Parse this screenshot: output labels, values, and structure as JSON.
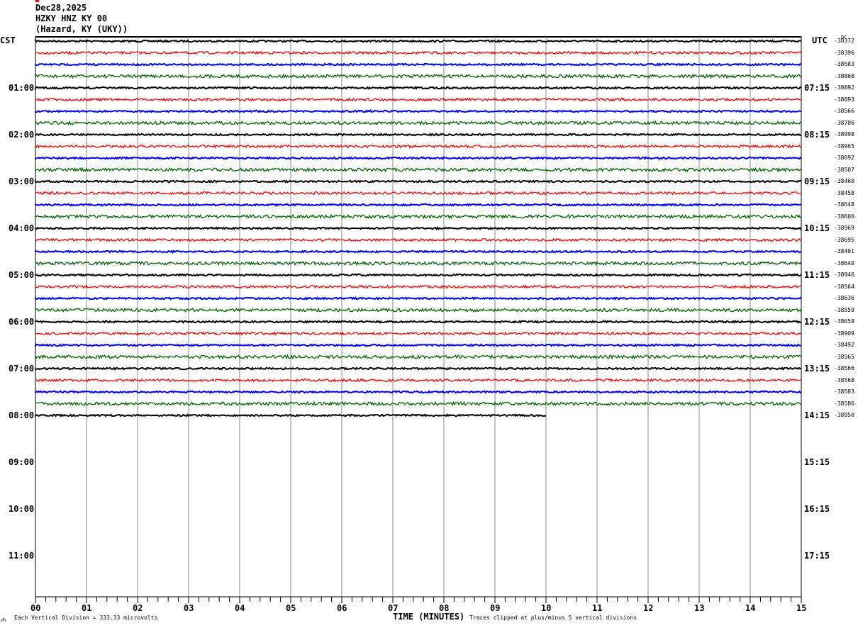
{
  "header": {
    "date": "Dec28,2025",
    "station": "HZKY HNZ KY 00",
    "location": "(Hazard, KY (UKY))"
  },
  "left_tz": "CST",
  "right_tz": "UTC",
  "dc_label": "DC",
  "footer": {
    "scale": "Each Vertical Division =  333.33 microvolts",
    "xlabel": "TIME (MINUTES)",
    "clip": "Traces clipped at plus/minus 5 vertical divisions"
  },
  "chart_data": {
    "type": "line",
    "xlabel": "TIME (MINUTES)",
    "xlim": [
      0,
      15
    ],
    "x_ticks": [
      "00",
      "01",
      "02",
      "03",
      "04",
      "05",
      "06",
      "07",
      "08",
      "09",
      "10",
      "11",
      "12",
      "13",
      "14",
      "15"
    ],
    "left_hour_labels": [
      "",
      "01:00",
      "02:00",
      "03:00",
      "04:00",
      "05:00",
      "06:00",
      "07:00",
      "08:00",
      "09:00",
      "10:00",
      "11:00"
    ],
    "right_hour_labels": [
      "",
      "07:15",
      "08:15",
      "09:15",
      "10:15",
      "11:15",
      "12:15",
      "13:15",
      "14:15",
      "15:15",
      "16:15",
      "17:15"
    ],
    "trace_colors": [
      "#000000",
      "#ff0000",
      "#0000ff",
      "#006400"
    ],
    "row_minutes": 15,
    "rows_per_hour": 4,
    "trace_count": 33,
    "last_trace_end_minute": 10.0,
    "dc_offsets": [
      "-38372",
      "-38396",
      "-38583",
      "-38868",
      "-38892",
      "-38893",
      "-38566",
      "-38706",
      "-38998",
      "-38965",
      "-38692",
      "-38507",
      "-38460",
      "-38458",
      "-38648",
      "-38606",
      "-38969",
      "-38695",
      "-38401",
      "-38640",
      "-38946",
      "-38564",
      "-38636",
      "-38559",
      "-38658",
      "-38909",
      "-38492",
      "-38565",
      "-38566",
      "-38568",
      "-38583",
      "-38586",
      "-38950"
    ]
  }
}
